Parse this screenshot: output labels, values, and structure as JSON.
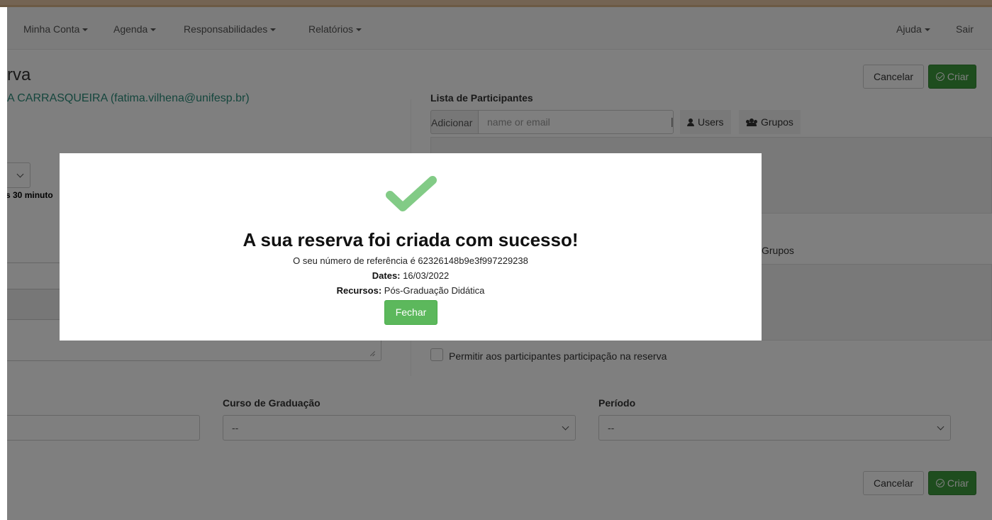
{
  "navbar": {
    "items": [
      {
        "label": "Minha Conta"
      },
      {
        "label": "Agenda"
      },
      {
        "label": "Responsabilidades"
      },
      {
        "label": "Relatórios"
      }
    ],
    "help_label": "Ajuda",
    "logout_label": "Sair"
  },
  "page": {
    "title_partial": "rva",
    "owner_partial": "A CARRASQUEIRA (fatima.vilhena@unifesp.br)"
  },
  "actions": {
    "cancel_label": "Cancelar",
    "create_label": "Criar"
  },
  "participants": {
    "heading": "Lista de Participantes",
    "add_label": "Adicionar",
    "add_placeholder": "name or email",
    "separator": "|",
    "users_label": "Users",
    "groups_label": "Grupos"
  },
  "invitees": {
    "groups_label": "Grupos"
  },
  "form": {
    "duration_partial": "s 30 minuto",
    "allow_participation_label": "Permitir aos participantes participação na reserva",
    "course_label": "Curso de Graduação",
    "course_value": "--",
    "period_label": "Período",
    "period_value": "--"
  },
  "modal": {
    "title": "A sua reserva foi criada com sucesso!",
    "reference_text": "O seu número de referência é 62326148b9e3f997229238",
    "dates_label": "Dates:",
    "dates_value": "16/03/2022",
    "resources_label": "Recursos:",
    "resources_value": "Pós-Graduação Didática",
    "close_label": "Fechar"
  },
  "colors": {
    "success": "#5cb85c",
    "check_icon": "#82cb86",
    "owner_link": "#2a8c7b"
  }
}
